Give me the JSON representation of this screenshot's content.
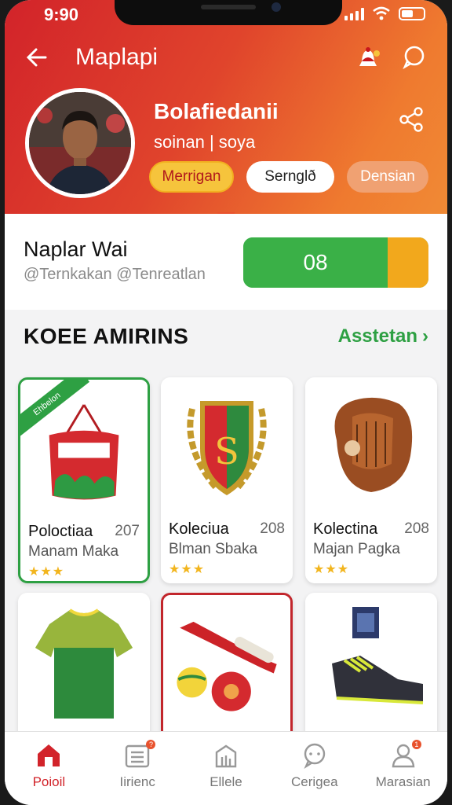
{
  "status": {
    "time": "9:90"
  },
  "topbar": {
    "title": "Maplapi"
  },
  "profile": {
    "name": "Bolafiedanii",
    "subtitle": "soinan | soya",
    "chips": [
      "Merrigan",
      "Sernglð",
      "Densian"
    ]
  },
  "user": {
    "name": "Naplar Wai",
    "handle": "@Ternkakan @Tenreatlan",
    "score": "08",
    "score_fraction": 0.78
  },
  "section": {
    "title": "KOEE AMIRINS",
    "link": "Asstetan"
  },
  "products": [
    {
      "title": "Poloctiaa",
      "count": "207",
      "sub": "Manam Maka",
      "stars": "★★★",
      "ribbon": "Ehbelon"
    },
    {
      "title": "Koleciua",
      "count": "208",
      "sub": "Blman Sbaka",
      "stars": "★★★"
    },
    {
      "title": "Kolectina",
      "count": "208",
      "sub": "Majan Pagka",
      "stars": "★★★"
    }
  ],
  "tabs": [
    {
      "label": "Poioil",
      "icon": "home-icon"
    },
    {
      "label": "Iirienc",
      "icon": "list-icon",
      "badge": "?"
    },
    {
      "label": "Ellele",
      "icon": "building-icon"
    },
    {
      "label": "Cerigea",
      "icon": "chat-bubble-icon"
    },
    {
      "label": "Marasian",
      "icon": "user-icon",
      "badge": "1"
    }
  ],
  "colors": {
    "brand_red": "#d2232a",
    "brand_orange": "#ef7a2f",
    "accent_green": "#2ea043",
    "accent_yellow": "#f2a81c"
  }
}
